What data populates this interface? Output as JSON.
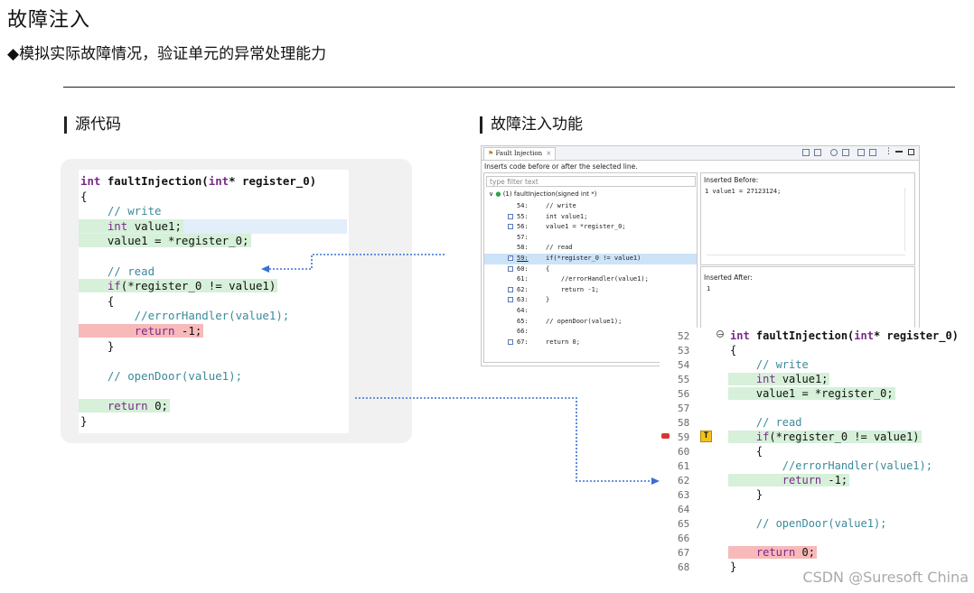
{
  "title": "故障注入",
  "subtitle": "◆模拟实际故障情况，验证单元的异常处理能力",
  "left_section_label": "源代码",
  "right_section_label": "故障注入功能",
  "source_code": [
    {
      "text": "int faultInjection(int* register_0)",
      "style": "plain"
    },
    {
      "text": "{",
      "style": "plain"
    },
    {
      "text": "    // write",
      "style": "comment"
    },
    {
      "text": "    int value1;",
      "style": "green"
    },
    {
      "text": "    value1 = *register_0;",
      "style": "green"
    },
    {
      "text": "",
      "style": "plain"
    },
    {
      "text": "    // read",
      "style": "comment"
    },
    {
      "text": "    if(*register_0 != value1)",
      "style": "green"
    },
    {
      "text": "    {",
      "style": "plain"
    },
    {
      "text": "        //errorHandler(value1);",
      "style": "comment"
    },
    {
      "text": "        return -1;",
      "style": "red"
    },
    {
      "text": "    }",
      "style": "plain"
    },
    {
      "text": "",
      "style": "plain"
    },
    {
      "text": "    // openDoor(value1);",
      "style": "comment"
    },
    {
      "text": "",
      "style": "plain"
    },
    {
      "text": "    return 0;",
      "style": "green"
    },
    {
      "text": "}",
      "style": "plain"
    }
  ],
  "panel": {
    "tab_label": "Fault Injection",
    "tab_close": "×",
    "description": "Inserts code before or after the selected line.",
    "filter_placeholder": "type filter text",
    "tree_root": "(1) faultInjection(signed int *)",
    "tree_rows": [
      {
        "line": "54:",
        "code": "// write",
        "checked": false,
        "box": false,
        "selected": false
      },
      {
        "line": "55:",
        "code": "int value1;",
        "checked": false,
        "box": true,
        "selected": false
      },
      {
        "line": "56:",
        "code": "value1 = *register_0;",
        "checked": false,
        "box": true,
        "selected": false
      },
      {
        "line": "57:",
        "code": "",
        "checked": false,
        "box": false,
        "selected": false
      },
      {
        "line": "58:",
        "code": "// read",
        "checked": false,
        "box": false,
        "selected": false
      },
      {
        "line": "59:",
        "code": "if(*register_0 != value1)",
        "checked": true,
        "box": true,
        "selected": true
      },
      {
        "line": "60:",
        "code": "{",
        "checked": false,
        "box": true,
        "selected": false
      },
      {
        "line": "61:",
        "code": "    //errorHandler(value1);",
        "checked": false,
        "box": false,
        "selected": false
      },
      {
        "line": "62:",
        "code": "    return -1;",
        "checked": false,
        "box": true,
        "selected": false
      },
      {
        "line": "63:",
        "code": "}",
        "checked": false,
        "box": true,
        "selected": false
      },
      {
        "line": "64:",
        "code": "",
        "checked": false,
        "box": false,
        "selected": false
      },
      {
        "line": "65:",
        "code": "// openDoor(value1);",
        "checked": false,
        "box": false,
        "selected": false
      },
      {
        "line": "66:",
        "code": "",
        "checked": false,
        "box": false,
        "selected": false
      },
      {
        "line": "67:",
        "code": "return 0;",
        "checked": false,
        "box": true,
        "selected": false
      }
    ],
    "inserted_before_label": "Inserted Before:",
    "inserted_before_code": "1 value1 = 27123124;",
    "inserted_after_label": "Inserted After:",
    "inserted_after_code": "1"
  },
  "editor": {
    "lines": [
      {
        "n": "52",
        "text": "int faultInjection(int* register_0)",
        "style": "plain"
      },
      {
        "n": "53",
        "text": "{",
        "style": "plain"
      },
      {
        "n": "54",
        "text": "    // write",
        "style": "comment"
      },
      {
        "n": "55",
        "text": "    int value1;",
        "style": "green"
      },
      {
        "n": "56",
        "text": "    value1 = *register_0;",
        "style": "green"
      },
      {
        "n": "57",
        "text": "",
        "style": "plain"
      },
      {
        "n": "58",
        "text": "    // read",
        "style": "comment"
      },
      {
        "n": "59",
        "text": "    if(*register_0 != value1)",
        "style": "green"
      },
      {
        "n": "60",
        "text": "    {",
        "style": "plain"
      },
      {
        "n": "61",
        "text": "        //errorHandler(value1);",
        "style": "comment"
      },
      {
        "n": "62",
        "text": "        return -1;",
        "style": "green"
      },
      {
        "n": "63",
        "text": "    }",
        "style": "plain"
      },
      {
        "n": "64",
        "text": "",
        "style": "plain"
      },
      {
        "n": "65",
        "text": "    // openDoor(value1);",
        "style": "comment"
      },
      {
        "n": "66",
        "text": "",
        "style": "plain"
      },
      {
        "n": "67",
        "text": "    return 0;",
        "style": "red"
      },
      {
        "n": "68",
        "text": "}",
        "style": "plain"
      }
    ],
    "marker_label": "T"
  },
  "watermark": "CSDN @Suresoft China",
  "colors": {
    "green_highlight": "#d6f0d9",
    "red_highlight": "#f7b9b9",
    "arrow_blue": "#3b6fd4",
    "keyword": "#7a2a8a",
    "comment": "#3a8a9a"
  }
}
